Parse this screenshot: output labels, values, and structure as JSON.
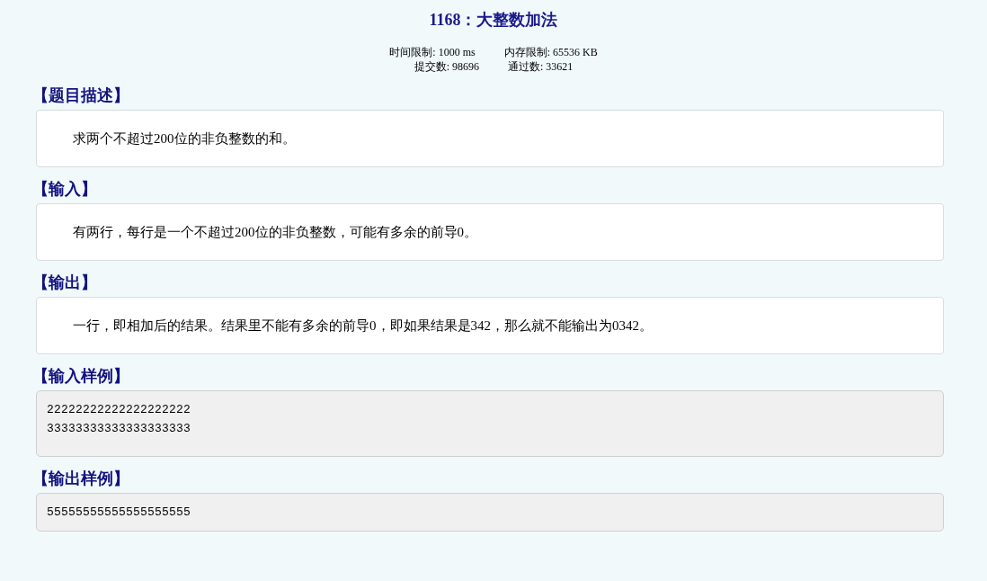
{
  "problem": {
    "title": "1168：大整数加法",
    "time_limit": "时间限制: 1000 ms",
    "memory_limit": "内存限制: 65536 KB",
    "submissions": "提交数: 98696",
    "accepted": "通过数: 33621"
  },
  "sections": [
    {
      "heading": "【题目描述】",
      "kind": "text",
      "lines": [
        "求两个不超过200位的非负整数的和。"
      ]
    },
    {
      "heading": "【输入】",
      "kind": "text",
      "lines": [
        "有两行，每行是一个不超过200位的非负整数，可能有多余的前导0。"
      ]
    },
    {
      "heading": "【输出】",
      "kind": "text",
      "lines": [
        "一行，即相加后的结果。结果里不能有多余的前导0，即如果结果是342，那么就不能输出为0342。"
      ]
    },
    {
      "heading": "【输入样例】",
      "kind": "sample",
      "lines": [
        "22222222222222222222",
        "33333333333333333333"
      ]
    },
    {
      "heading": "【输出样例】",
      "kind": "sample",
      "lines": [
        "55555555555555555555"
      ]
    }
  ]
}
